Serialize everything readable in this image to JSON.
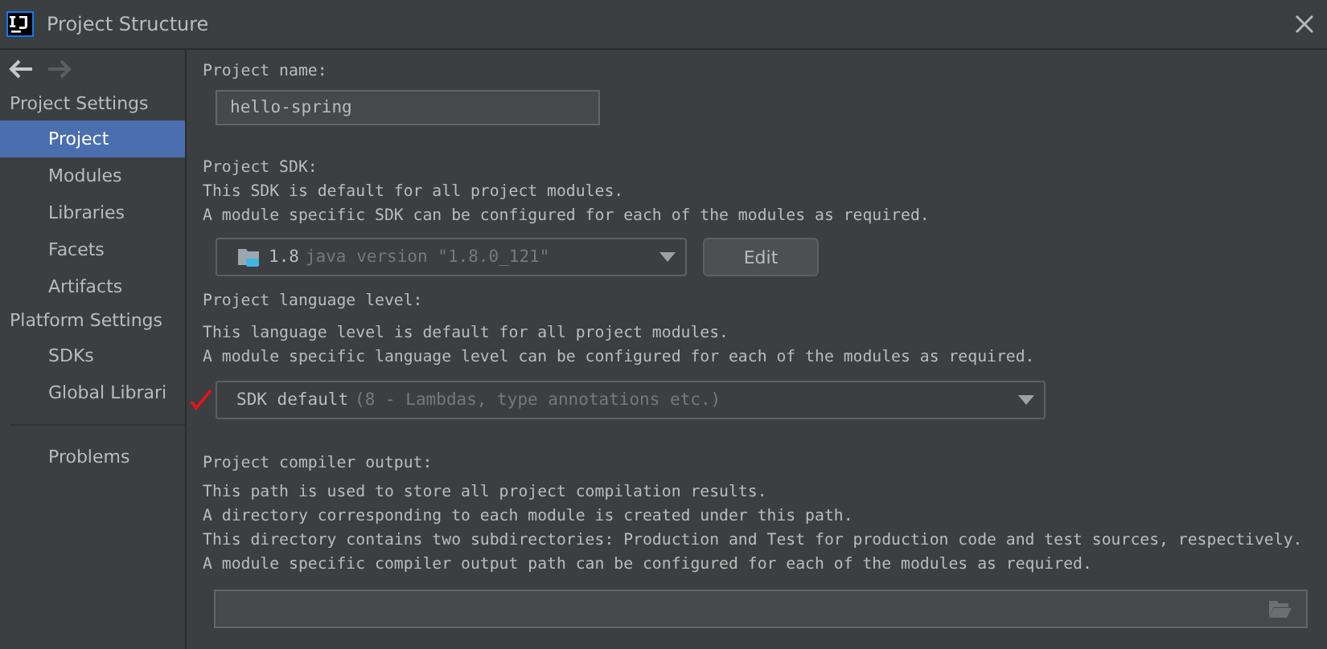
{
  "window": {
    "title": "Project Structure"
  },
  "sidebar": {
    "groups": [
      {
        "heading": "Project Settings",
        "items": [
          {
            "label": "Project",
            "selected": true
          },
          {
            "label": "Modules",
            "selected": false
          },
          {
            "label": "Libraries",
            "selected": false
          },
          {
            "label": "Facets",
            "selected": false
          },
          {
            "label": "Artifacts",
            "selected": false
          }
        ]
      },
      {
        "heading": "Platform Settings",
        "items": [
          {
            "label": "SDKs",
            "selected": false
          },
          {
            "label": "Global Librari",
            "selected": false
          }
        ]
      }
    ],
    "extra_items": [
      {
        "label": "Problems",
        "selected": false
      }
    ]
  },
  "project_name": {
    "label": "Project name:",
    "value": "hello-spring"
  },
  "project_sdk": {
    "label": "Project SDK:",
    "description": [
      "This SDK is default for all project modules.",
      "A module specific SDK can be configured for each of the modules as required."
    ],
    "version": "1.8",
    "detail": "java version \"1.8.0_121\"",
    "button": "Edit"
  },
  "language_level": {
    "label": "Project language level:",
    "description": [
      "This language level is default for all project modules.",
      "A module specific language level can be configured for each of the modules as required."
    ],
    "value": "SDK default",
    "hint": "(8 - Lambdas, type annotations etc.)"
  },
  "compiler_output": {
    "label": "Project compiler output:",
    "description": [
      "This path is used to store all project compilation results.",
      "A directory corresponding to each module is created under this path.",
      "This directory contains two subdirectories: Production and Test for production code and test sources, respectively.",
      "A module specific compiler output path can be configured for each of the modules as required."
    ]
  }
}
